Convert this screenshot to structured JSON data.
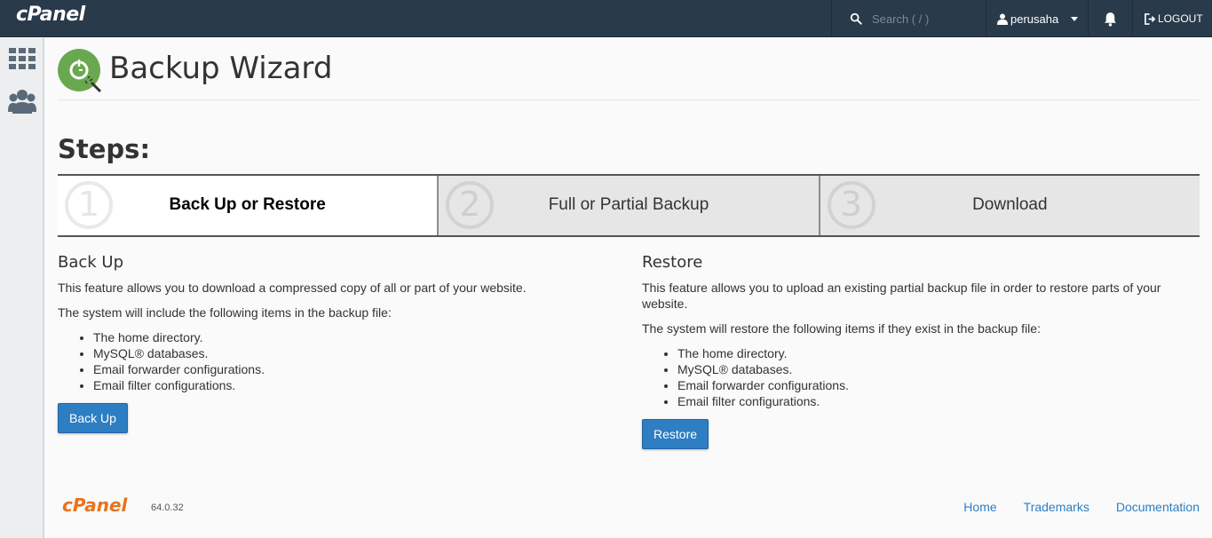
{
  "topbar": {
    "logo": "cPanel",
    "search_placeholder": "Search ( / )",
    "username": "perusaha",
    "logout_label": "LOGOUT"
  },
  "sidebar": {
    "items": [
      {
        "icon": "grid-icon"
      },
      {
        "icon": "users-icon"
      }
    ]
  },
  "page": {
    "title": "Backup Wizard",
    "steps_title": "Steps:"
  },
  "steps": [
    {
      "number": "1",
      "label": "Back Up or Restore",
      "active": true
    },
    {
      "number": "2",
      "label": "Full or Partial Backup",
      "active": false
    },
    {
      "number": "3",
      "label": "Download",
      "active": false
    }
  ],
  "backup": {
    "heading": "Back Up",
    "description": "This feature allows you to download a compressed copy of all or part of your website.",
    "list_intro": "The system will include the following items in the backup file:",
    "items": [
      "The home directory.",
      "MySQL® databases.",
      "Email forwarder configurations.",
      "Email filter configurations."
    ],
    "button_label": "Back Up"
  },
  "restore": {
    "heading": "Restore",
    "description": "This feature allows you to upload an existing partial backup file in order to restore parts of your website.",
    "list_intro": "The system will restore the following items if they exist in the backup file:",
    "items": [
      "The home directory.",
      "MySQL® databases.",
      "Email forwarder configurations.",
      "Email filter configurations."
    ],
    "button_label": "Restore"
  },
  "footer": {
    "logo": "cPanel",
    "version": "64.0.32",
    "links": [
      "Home",
      "Trademarks",
      "Documentation"
    ]
  },
  "colors": {
    "topbar": "#293a4a",
    "accent": "#2d7ec2",
    "footer_logo": "#e8731e",
    "wizard_icon": "#6aa84f"
  }
}
